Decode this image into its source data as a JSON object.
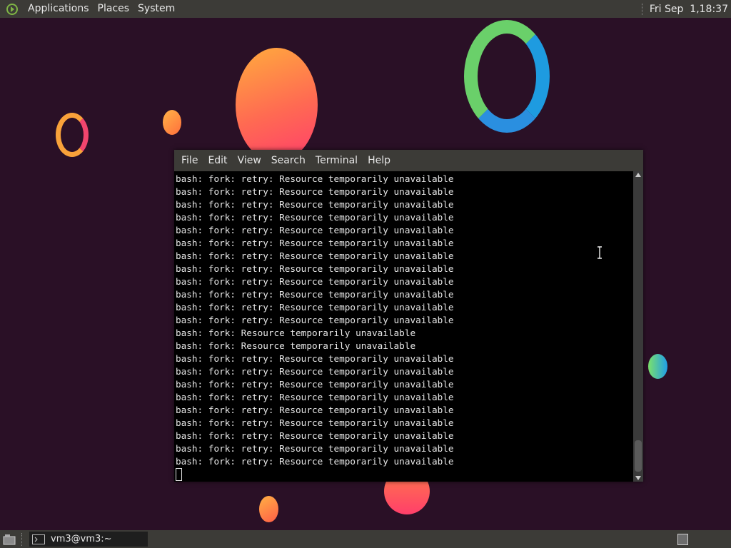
{
  "top_panel": {
    "menus": [
      "Applications",
      "Places",
      "System"
    ],
    "clock": "Fri Sep  1,18:37"
  },
  "terminal": {
    "menu": [
      "File",
      "Edit",
      "View",
      "Search",
      "Terminal",
      "Help"
    ],
    "lines": [
      "bash: fork: retry: Resource temporarily unavailable",
      "bash: fork: retry: Resource temporarily unavailable",
      "bash: fork: retry: Resource temporarily unavailable",
      "bash: fork: retry: Resource temporarily unavailable",
      "bash: fork: retry: Resource temporarily unavailable",
      "bash: fork: retry: Resource temporarily unavailable",
      "bash: fork: retry: Resource temporarily unavailable",
      "bash: fork: retry: Resource temporarily unavailable",
      "bash: fork: retry: Resource temporarily unavailable",
      "bash: fork: retry: Resource temporarily unavailable",
      "bash: fork: retry: Resource temporarily unavailable",
      "bash: fork: retry: Resource temporarily unavailable",
      "bash: fork: Resource temporarily unavailable",
      "bash: fork: Resource temporarily unavailable",
      "bash: fork: retry: Resource temporarily unavailable",
      "bash: fork: retry: Resource temporarily unavailable",
      "bash: fork: retry: Resource temporarily unavailable",
      "bash: fork: retry: Resource temporarily unavailable",
      "bash: fork: retry: Resource temporarily unavailable",
      "bash: fork: retry: Resource temporarily unavailable",
      "bash: fork: retry: Resource temporarily unavailable",
      "bash: fork: retry: Resource temporarily unavailable",
      "bash: fork: retry: Resource temporarily unavailable"
    ]
  },
  "taskbar": {
    "window_title": "vm3@vm3:~"
  },
  "icons": {
    "panel_logo": "mate-logo-icon",
    "show_desktop": "show-desktop-icon",
    "task": "terminal-icon",
    "workspace": "workspace-switcher-icon",
    "pointer": "ibeam-cursor-icon"
  },
  "colors": {
    "panel": "#3c3b37",
    "terminal_bg": "#000000",
    "terminal_fg": "#e6e6e6",
    "desktop": "#2a1026"
  }
}
